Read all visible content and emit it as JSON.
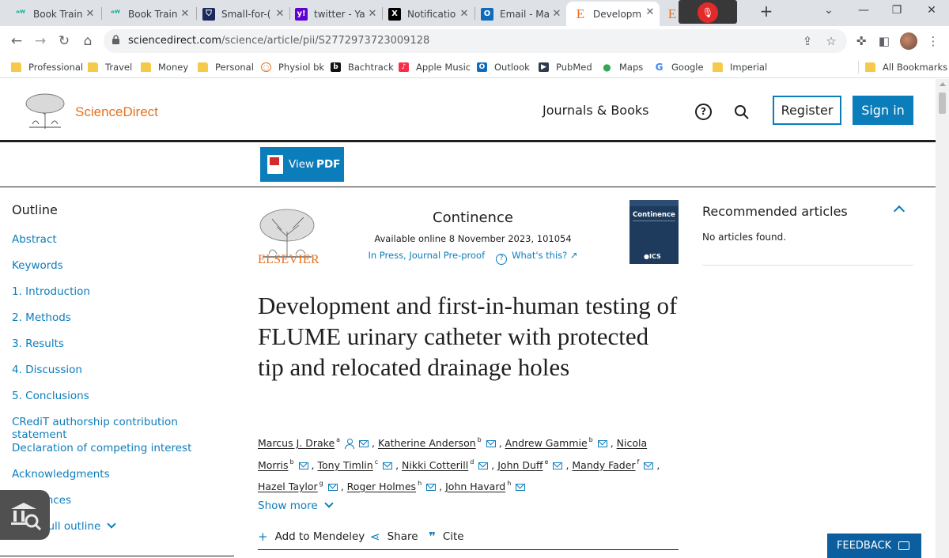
{
  "browser": {
    "tabs": [
      {
        "title": "Book Train",
        "icon": "trainline-icon",
        "active": false
      },
      {
        "title": "Book Train",
        "icon": "trainline-icon",
        "active": false
      },
      {
        "title": "Small-for-(",
        "icon": "shield-icon",
        "active": false
      },
      {
        "title": "twitter - Ya",
        "icon": "yahoo-icon",
        "active": false
      },
      {
        "title": "Notificatio",
        "icon": "x-icon",
        "active": false
      },
      {
        "title": "Email - Ma",
        "icon": "outlook-icon",
        "active": false
      },
      {
        "title": "Developm",
        "icon": "elsevier-e-icon",
        "active": true
      },
      {
        "title": "",
        "icon": "elsevier-e-icon",
        "active": false
      }
    ],
    "url_host": "sciencedirect.com",
    "url_path": "/science/article/pii/S2772973723009128",
    "bookmarks": [
      {
        "label": "Professional",
        "icon": "folder-icon"
      },
      {
        "label": "Travel",
        "icon": "folder-icon"
      },
      {
        "label": "Money",
        "icon": "folder-icon"
      },
      {
        "label": "Personal",
        "icon": "folder-icon"
      },
      {
        "label": "Physiol bk",
        "icon": "physiol-icon"
      },
      {
        "label": "Bachtrack",
        "icon": "bachtrack-icon"
      },
      {
        "label": "Apple Music",
        "icon": "apple-music-icon"
      },
      {
        "label": "Outlook",
        "icon": "outlook-icon"
      },
      {
        "label": "PubMed",
        "icon": "pubmed-icon"
      },
      {
        "label": "Maps",
        "icon": "maps-icon"
      },
      {
        "label": "Google",
        "icon": "google-icon"
      },
      {
        "label": "Imperial",
        "icon": "folder-icon"
      }
    ],
    "all_bookmarks": "All Bookmarks"
  },
  "header": {
    "brand": "ScienceDirect",
    "journals_books": "Journals & Books",
    "register": "Register",
    "sign_in": "Sign in"
  },
  "pdf_button": {
    "prefix": "View",
    "bold": "PDF"
  },
  "outline": {
    "title": "Outline",
    "items": [
      "Abstract",
      "Keywords",
      "1. Introduction",
      "2. Methods",
      "3. Results",
      "4. Discussion",
      "5. Conclusions",
      "CRediT authorship contribution statement",
      "Declaration of competing interest",
      "Acknowledgments",
      "References"
    ],
    "show_full": "Show full outline"
  },
  "article": {
    "publisher": "ELSEVIER",
    "journal": "Continence",
    "availability": "Available online 8 November 2023, 101054",
    "status": "In Press, Journal Pre-proof",
    "whats_this": "What's this?",
    "cover_title": "Continence",
    "cover_badge": "ICS",
    "title": "Development and first-in-human testing of FLUME urinary catheter with protected tip and relocated drainage holes",
    "authors": [
      {
        "name": "Marcus J. Drake",
        "sup": "a",
        "person": true
      },
      {
        "name": "Katherine Anderson",
        "sup": "b"
      },
      {
        "name": "Andrew Gammie",
        "sup": "b"
      },
      {
        "name": "Nicola Morris",
        "sup": "b"
      },
      {
        "name": "Tony Timlin",
        "sup": "c"
      },
      {
        "name": "Nikki Cotterill",
        "sup": "d"
      },
      {
        "name": "John Duff",
        "sup": "e"
      },
      {
        "name": "Mandy Fader",
        "sup": "f"
      },
      {
        "name": "Hazel Taylor",
        "sup": "g"
      },
      {
        "name": "Roger Holmes",
        "sup": "h"
      },
      {
        "name": "John Havard",
        "sup": "h"
      }
    ],
    "show_more": "Show more",
    "actions": {
      "mendeley": "Add to Mendeley",
      "share": "Share",
      "cite": "Cite"
    }
  },
  "recommended": {
    "title": "Recommended articles",
    "empty": "No articles found."
  },
  "feedback": "FEEDBACK",
  "colors": {
    "accent": "#0c7dbb",
    "brand_orange": "#e9711c",
    "feedback": "#0c5f9e"
  }
}
